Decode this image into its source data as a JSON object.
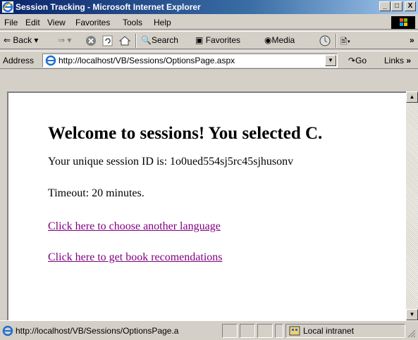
{
  "window": {
    "title": "Session Tracking - Microsoft Internet Explorer",
    "minimize": "_",
    "maximize": "□",
    "close": "X"
  },
  "menu": [
    "File",
    "Edit",
    "View",
    "Favorites",
    "Tools",
    "Help"
  ],
  "toolbar": {
    "back": "Back",
    "search": "Search",
    "favorites": "Favorites",
    "media": "Media",
    "more": "»"
  },
  "address": {
    "label": "Address",
    "url": "http://localhost/VB/Sessions/OptionsPage.aspx",
    "go": "Go",
    "links": "Links"
  },
  "page": {
    "heading": "Welcome to sessions! You selected C.",
    "session_id": "Your unique session ID is: 1o0ued554sj5rc45sjhusonv",
    "timeout": "Timeout: 20 minutes.",
    "link_language": "Click here to choose another language",
    "link_books": "Click here to get book recomendations"
  },
  "status": {
    "url": "http://localhost/VB/Sessions/OptionsPage.a",
    "zone": "Local intranet"
  },
  "colors": {
    "titlebar": "#0a246a",
    "link_visited": "#800080",
    "chrome": "#d4d0c8"
  }
}
